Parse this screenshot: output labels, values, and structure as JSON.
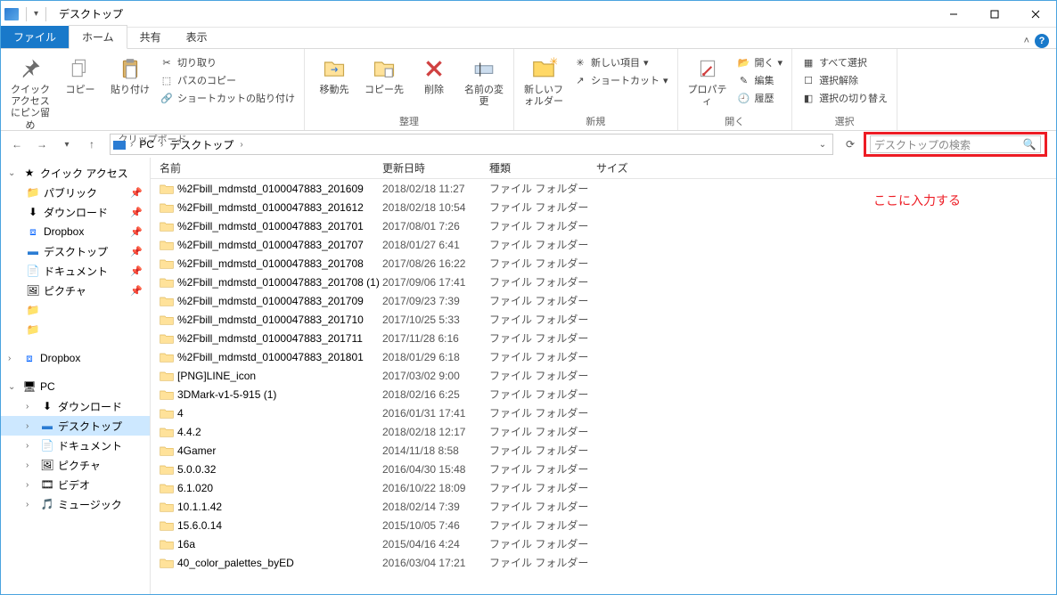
{
  "title": "デスクトップ",
  "tabs": {
    "file": "ファイル",
    "home": "ホーム",
    "share": "共有",
    "view": "表示"
  },
  "ribbon": {
    "clipboard": {
      "label": "クリップボード",
      "pin": "クイック アクセスにピン留め",
      "copy": "コピー",
      "paste": "貼り付け",
      "cut": "切り取り",
      "copypath": "パスのコピー",
      "pasteshortcut": "ショートカットの貼り付け"
    },
    "organize": {
      "label": "整理",
      "moveto": "移動先",
      "copyto": "コピー先",
      "delete": "削除",
      "rename": "名前の変更"
    },
    "new": {
      "label": "新規",
      "newfolder": "新しいフォルダー",
      "newitem": "新しい項目",
      "shortcut": "ショートカット"
    },
    "open": {
      "label": "開く",
      "properties": "プロパティ",
      "open": "開く",
      "edit": "編集",
      "history": "履歴"
    },
    "select": {
      "label": "選択",
      "selectall": "すべて選択",
      "selectnone": "選択解除",
      "invert": "選択の切り替え"
    }
  },
  "breadcrumb": {
    "pc": "PC",
    "desktop": "デスクトップ"
  },
  "search_placeholder": "デスクトップの検索",
  "annotation": "ここに入力する",
  "sidebar": {
    "quick": "クイック アクセス",
    "public": "パブリック",
    "downloads": "ダウンロード",
    "dropbox": "Dropbox",
    "desktop": "デスクトップ",
    "documents": "ドキュメント",
    "pictures": "ピクチャ",
    "dropbox2": "Dropbox",
    "pc": "PC",
    "pc_downloads": "ダウンロード",
    "pc_desktop": "デスクトップ",
    "pc_documents": "ドキュメント",
    "pc_pictures": "ピクチャ",
    "pc_videos": "ビデオ",
    "pc_music": "ミュージック"
  },
  "columns": {
    "name": "名前",
    "date": "更新日時",
    "type": "種類",
    "size": "サイズ"
  },
  "filetype": "ファイル フォルダー",
  "files": [
    {
      "name": "%2Fbill_mdmstd_0100047883_201609",
      "date": "2018/02/18 11:27"
    },
    {
      "name": "%2Fbill_mdmstd_0100047883_201612",
      "date": "2018/02/18 10:54"
    },
    {
      "name": "%2Fbill_mdmstd_0100047883_201701",
      "date": "2017/08/01 7:26"
    },
    {
      "name": "%2Fbill_mdmstd_0100047883_201707",
      "date": "2018/01/27 6:41"
    },
    {
      "name": "%2Fbill_mdmstd_0100047883_201708",
      "date": "2017/08/26 16:22"
    },
    {
      "name": "%2Fbill_mdmstd_0100047883_201708 (1)",
      "date": "2017/09/06 17:41"
    },
    {
      "name": "%2Fbill_mdmstd_0100047883_201709",
      "date": "2017/09/23 7:39"
    },
    {
      "name": "%2Fbill_mdmstd_0100047883_201710",
      "date": "2017/10/25 5:33"
    },
    {
      "name": "%2Fbill_mdmstd_0100047883_201711",
      "date": "2017/11/28 6:16"
    },
    {
      "name": "%2Fbill_mdmstd_0100047883_201801",
      "date": "2018/01/29 6:18"
    },
    {
      "name": "[PNG]LINE_icon",
      "date": "2017/03/02 9:00"
    },
    {
      "name": "3DMark-v1-5-915 (1)",
      "date": "2018/02/16 6:25"
    },
    {
      "name": "4",
      "date": "2016/01/31 17:41"
    },
    {
      "name": "4.4.2",
      "date": "2018/02/18 12:17"
    },
    {
      "name": "4Gamer",
      "date": "2014/11/18 8:58"
    },
    {
      "name": "5.0.0.32",
      "date": "2016/04/30 15:48"
    },
    {
      "name": "6.1.020",
      "date": "2016/10/22 18:09"
    },
    {
      "name": "10.1.1.42",
      "date": "2018/02/14 7:39"
    },
    {
      "name": "15.6.0.14",
      "date": "2015/10/05 7:46"
    },
    {
      "name": "16a",
      "date": "2015/04/16 4:24"
    },
    {
      "name": "40_color_palettes_byED",
      "date": "2016/03/04 17:21"
    }
  ]
}
